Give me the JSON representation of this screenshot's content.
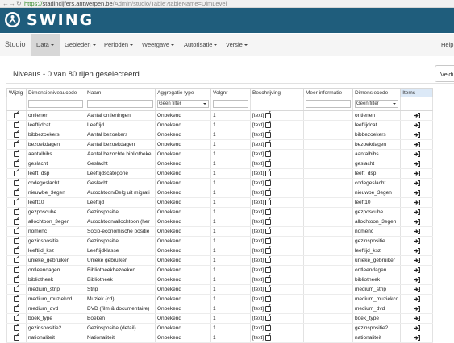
{
  "browser": {
    "url_scheme": "https://",
    "url_host": "stadincijfers.antwerpen.be",
    "url_path": "/Admin/studio/Table?tableName=DimLevel"
  },
  "brand": {
    "logo_text": "SWING"
  },
  "menu": {
    "studio": "Studio",
    "items": [
      "Data",
      "Gebieden",
      "Perioden",
      "Weergave",
      "Autorisatie",
      "Versie"
    ],
    "help": "Help"
  },
  "page": {
    "title": "Niveaus - 0 van 80 rijen geselecteerd",
    "right_button": "Veldi"
  },
  "table": {
    "columns": [
      "Wijzig",
      "Dimensieniveaucode",
      "Naam",
      "Aggregatie type",
      "Volgnr",
      "Beschrijving",
      "Meer informatie",
      "Dimensiecode",
      "Items"
    ],
    "filter_placeholder": "Geen filter",
    "rows": [
      {
        "code": "ontlenen",
        "naam": "Aantal ontleningen",
        "agg": "Onbekend",
        "volgnr": "1",
        "beschrijving": "[text]",
        "dimcode": "ontlenen"
      },
      {
        "code": "leeftijdcat",
        "naam": "Leeftijd",
        "agg": "Onbekend",
        "volgnr": "1",
        "beschrijving": "[text]",
        "dimcode": "leeftijdcat"
      },
      {
        "code": "bibbezoekers",
        "naam": "Aantal bezoekers",
        "agg": "Onbekend",
        "volgnr": "1",
        "beschrijving": "[text]",
        "dimcode": "bibbezoekers"
      },
      {
        "code": "bezoekdagen",
        "naam": "Aantal bezoekdagen",
        "agg": "Onbekend",
        "volgnr": "1",
        "beschrijving": "[text]",
        "dimcode": "bezoekdagen"
      },
      {
        "code": "aantalbibs",
        "naam": "Aantal bezochte bibliotheke",
        "agg": "Onbekend",
        "volgnr": "1",
        "beschrijving": "[text]",
        "dimcode": "aantalbibs"
      },
      {
        "code": "geslacht",
        "naam": "Geslacht",
        "agg": "Onbekend",
        "volgnr": "1",
        "beschrijving": "[text]",
        "dimcode": "geslacht"
      },
      {
        "code": "leeft_dsp",
        "naam": "Leeftijdscategorie",
        "agg": "Onbekend",
        "volgnr": "1",
        "beschrijving": "[text]",
        "dimcode": "leeft_dsp"
      },
      {
        "code": "codegeslacht",
        "naam": "Geslacht",
        "agg": "Onbekend",
        "volgnr": "1",
        "beschrijving": "[text]",
        "dimcode": "codegeslacht"
      },
      {
        "code": "nieuwbe_3egen",
        "naam": "Autochtoon/Belg uit migrati",
        "agg": "Onbekend",
        "volgnr": "1",
        "beschrijving": "[text]",
        "dimcode": "nieuwbe_3egen"
      },
      {
        "code": "leeft10",
        "naam": "Leeftijd",
        "agg": "Onbekend",
        "volgnr": "1",
        "beschrijving": "[text]",
        "dimcode": "leeft10"
      },
      {
        "code": "gezposcube",
        "naam": "Gezinspositie",
        "agg": "Onbekend",
        "volgnr": "1",
        "beschrijving": "[text]",
        "dimcode": "gezposcube"
      },
      {
        "code": "allochtoon_3egen",
        "naam": "Autochtoon/allochtoon (her",
        "agg": "Onbekend",
        "volgnr": "1",
        "beschrijving": "[text]",
        "dimcode": "allochtoon_3egen"
      },
      {
        "code": "nomenc",
        "naam": "Socio-economische positie",
        "agg": "Onbekend",
        "volgnr": "1",
        "beschrijving": "[text]",
        "dimcode": "nomenc"
      },
      {
        "code": "gezinspositie",
        "naam": "Gezinspositie",
        "agg": "Onbekend",
        "volgnr": "1",
        "beschrijving": "[text]",
        "dimcode": "gezinspositie"
      },
      {
        "code": "leeftijd_ksz",
        "naam": "Leeftijdklasse",
        "agg": "Onbekend",
        "volgnr": "1",
        "beschrijving": "[text]",
        "dimcode": "leeftijd_ksz"
      },
      {
        "code": "unieke_gebruiker",
        "naam": "Unieke gebruiker",
        "agg": "Onbekend",
        "volgnr": "1",
        "beschrijving": "[text]",
        "dimcode": "unieke_gebruiker"
      },
      {
        "code": "ontleendagen",
        "naam": "Bibliotheekbezoeken",
        "agg": "Onbekend",
        "volgnr": "1",
        "beschrijving": "[text]",
        "dimcode": "ontleendagen"
      },
      {
        "code": "bibliotheek",
        "naam": "Bibliotheek",
        "agg": "Onbekend",
        "volgnr": "1",
        "beschrijving": "[text]",
        "dimcode": "bibliotheek"
      },
      {
        "code": "medium_strip",
        "naam": "Strip",
        "agg": "Onbekend",
        "volgnr": "1",
        "beschrijving": "[text]",
        "dimcode": "medium_strip"
      },
      {
        "code": "medium_muziekcd",
        "naam": "Muziek (cd)",
        "agg": "Onbekend",
        "volgnr": "1",
        "beschrijving": "[text]",
        "dimcode": "medium_muziekcd"
      },
      {
        "code": "medium_dvd",
        "naam": "DVD (film & documentaire)",
        "agg": "Onbekend",
        "volgnr": "1",
        "beschrijving": "[text]",
        "dimcode": "medium_dvd"
      },
      {
        "code": "boek_type",
        "naam": "Boeken",
        "agg": "Onbekend",
        "volgnr": "1",
        "beschrijving": "[text]",
        "dimcode": "boek_type"
      },
      {
        "code": "gezinspositie2",
        "naam": "Gezinspositie (detail)",
        "agg": "Onbekend",
        "volgnr": "1",
        "beschrijving": "[text]",
        "dimcode": "gezinspositie2"
      },
      {
        "code": "nationaliteit",
        "naam": "Nationaliteit",
        "agg": "Onbekend",
        "volgnr": "1",
        "beschrijving": "[text]",
        "dimcode": "nationaliteit"
      }
    ]
  },
  "icons": {
    "edit": "edit-icon",
    "item_link": "sign-in-icon",
    "description_edit": "edit-icon"
  },
  "colors": {
    "brand_bar": "#1f5d7c",
    "items_header": "#dce9f7",
    "active_menu": "#d7d7d7"
  }
}
